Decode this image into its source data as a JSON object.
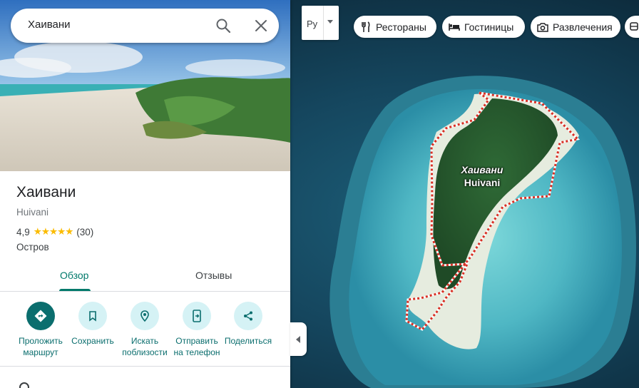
{
  "search": {
    "value": "Хаивани"
  },
  "place": {
    "title": "Хаивани",
    "subtitle": "Huivani",
    "rating": "4,9",
    "stars": 5,
    "reviews_count": "(30)",
    "type": "Остров"
  },
  "tabs": [
    {
      "label": "Обзор",
      "active": true
    },
    {
      "label": "Отзывы",
      "active": false
    }
  ],
  "actions": [
    {
      "label": "Проложить маршрут",
      "icon": "directions-icon"
    },
    {
      "label": "Сохранить",
      "icon": "bookmark-icon"
    },
    {
      "label": "Искать поблизости",
      "icon": "nearby-icon"
    },
    {
      "label": "Отправить на телефон",
      "icon": "send-to-phone-icon"
    },
    {
      "label": "Поделиться",
      "icon": "share-icon"
    }
  ],
  "map": {
    "layer_label": "Ру",
    "chips": [
      {
        "label": "Рестораны",
        "icon": "restaurant-icon"
      },
      {
        "label": "Гостиницы",
        "icon": "hotel-icon"
      },
      {
        "label": "Развлечения",
        "icon": "camera-icon"
      }
    ],
    "label_ru": "Хаивани",
    "label_en": "Huivani"
  },
  "colors": {
    "accent": "#00796b",
    "action_bg": "#d5f2f5",
    "star": "#fbbc04"
  }
}
